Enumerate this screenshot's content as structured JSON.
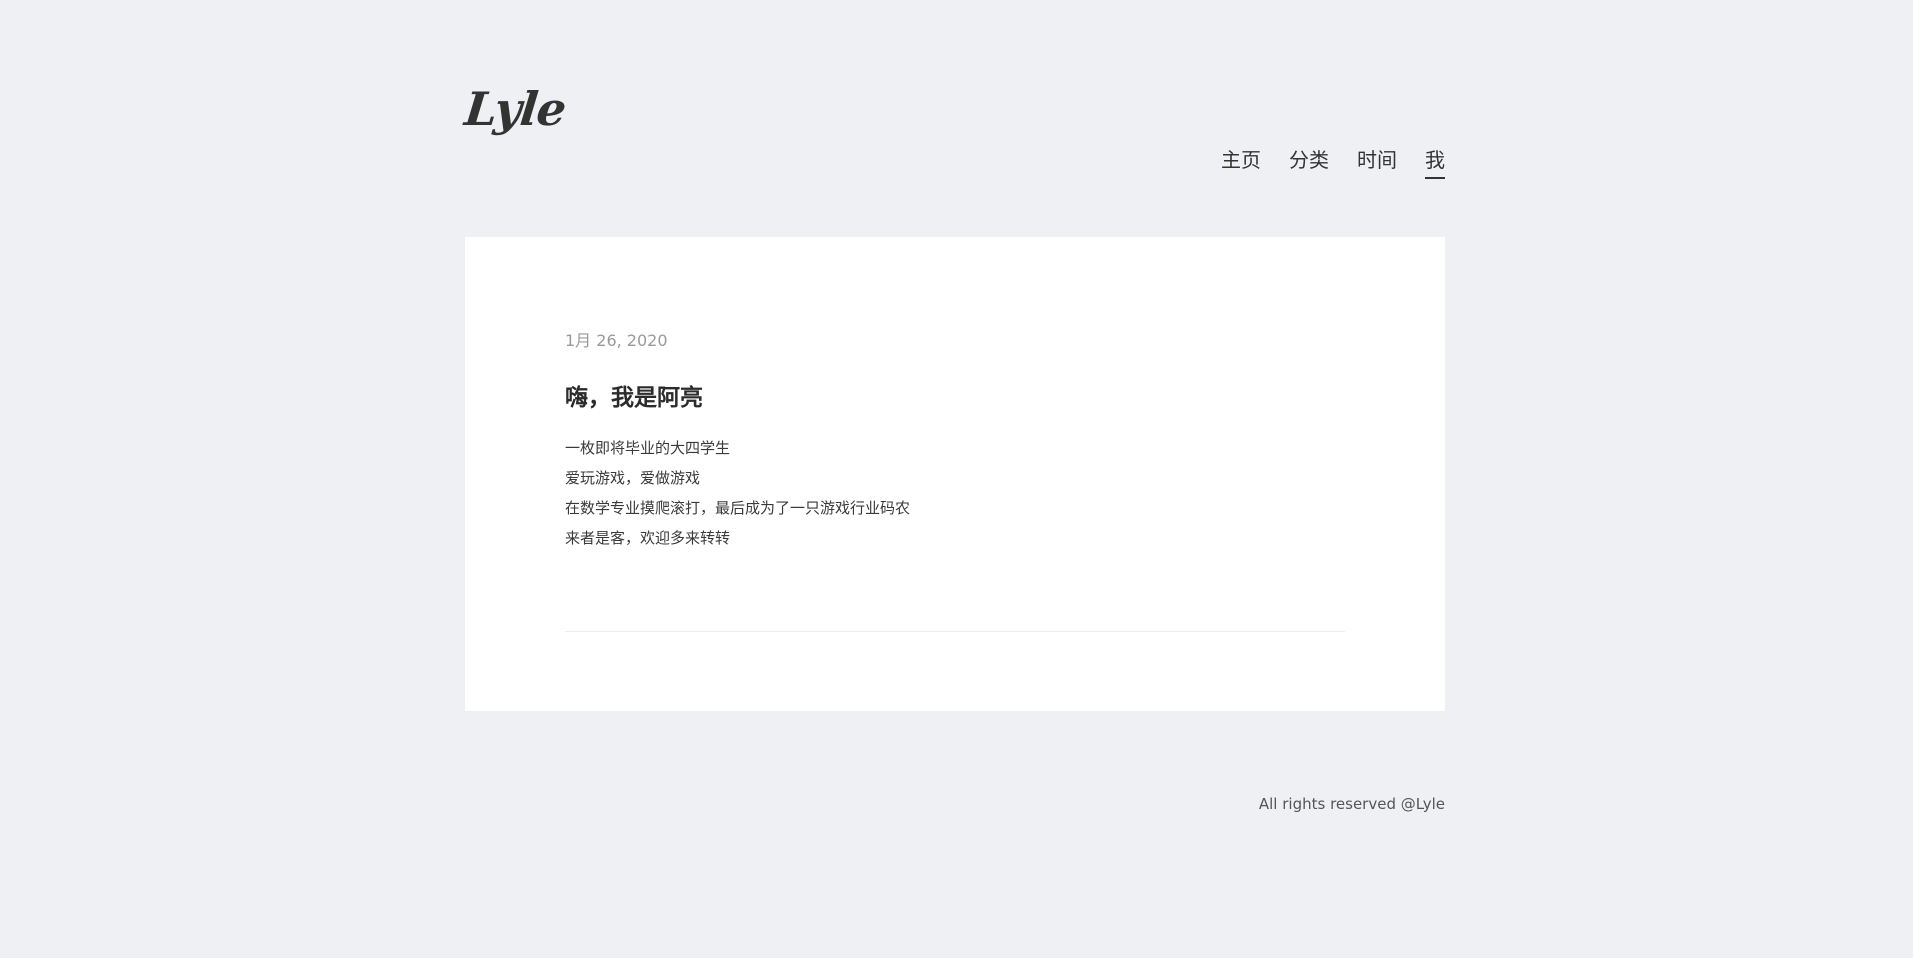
{
  "header": {
    "logo_text": "Lyle",
    "nav": [
      {
        "label": "主页"
      },
      {
        "label": "分类"
      },
      {
        "label": "时间"
      },
      {
        "label": "我",
        "active": true
      }
    ]
  },
  "post": {
    "date": "1月 26, 2020",
    "title": "嗨，我是阿亮",
    "lines": [
      "一枚即将毕业的大四学生",
      "爱玩游戏，爱做游戏",
      "在数学专业摸爬滚打，最后成为了一只游戏行业码农",
      "来者是客，欢迎多来转转"
    ]
  },
  "footer": {
    "text": "All rights reserved @Lyle"
  },
  "colors": {
    "background": "#eff0f4",
    "card": "#ffffff",
    "text": "#333333",
    "muted": "#9a9a9a"
  }
}
